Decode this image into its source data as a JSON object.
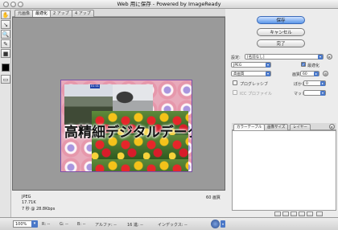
{
  "window": {
    "title": "Web 用に保存 - Powered by ImageReady"
  },
  "tabs": [
    {
      "label": "元画像",
      "active": false
    },
    {
      "label": "最適化",
      "active": true
    },
    {
      "label": "2 アップ",
      "active": false
    },
    {
      "label": "4 アップ",
      "active": false
    }
  ],
  "preview": {
    "overlay_text": "高精細デジタルデータ",
    "badge_text": "01 01"
  },
  "info": {
    "format": "JPEG",
    "size": "17.71K",
    "time": "7 秒 @ 28.8Kbps",
    "quality": "60 画質"
  },
  "statusbar": {
    "zoom": "100%",
    "r": "R: --",
    "g": "G: --",
    "b": "B: --",
    "alpha": "アルファ: --",
    "hex": "16 進: --",
    "index": "インデックス: --"
  },
  "right": {
    "save_label": "保存",
    "cancel_label": "キャンセル",
    "done_label": "完了",
    "settings_label": "設定:",
    "settings_value": "[名前なし]",
    "format_value": "JPEG",
    "optimized_label": "最適化",
    "quality_preset": "高画質",
    "quality_label": "画質:",
    "quality_value": "60",
    "progressive_label": "プログレッシブ",
    "blur_label": "ぼかし:",
    "blur_value": "0",
    "icc_label": "ICC プロファイル",
    "matte_label": "マット:",
    "panel_tabs": [
      "カラーテーブル",
      "画像サイズ",
      "レイヤー"
    ]
  }
}
